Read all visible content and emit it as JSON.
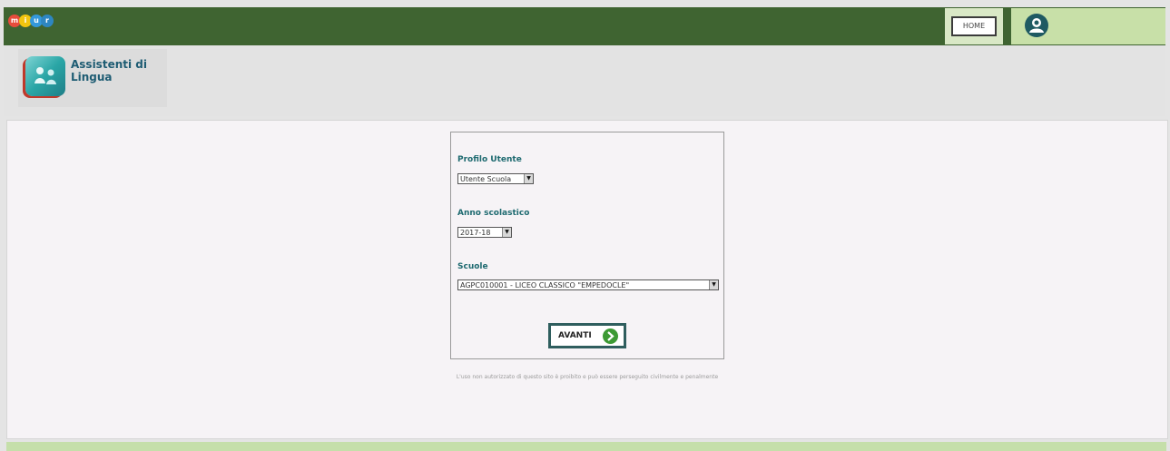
{
  "header": {
    "logo_letters": [
      "m",
      "i",
      "u",
      "r"
    ],
    "logo_colors": [
      "#e74c3c",
      "#f1c40f",
      "#3498db",
      "#2e86c1"
    ],
    "home_label": "HOME",
    "user_icon": "user-account-icon"
  },
  "app": {
    "title_line1": "Assistenti di",
    "title_line2": "Lingua"
  },
  "form": {
    "profilo_label": "Profilo Utente",
    "profilo_value": "Utente Scuola",
    "anno_label": "Anno scolastico",
    "anno_value": "2017-18",
    "scuole_label": "Scuole",
    "scuole_value": "AGPC010001 - LICEO CLASSICO \"EMPEDOCLE\"",
    "avanti_label": "AVANTI"
  },
  "disclaimer": "L'uso non autorizzato di questo sito è proibito e può essere perseguito civilmente e penalmente",
  "colors": {
    "topbar": "#3f6431",
    "accent": "#1e6a70",
    "footer": "#c5dfaa"
  }
}
